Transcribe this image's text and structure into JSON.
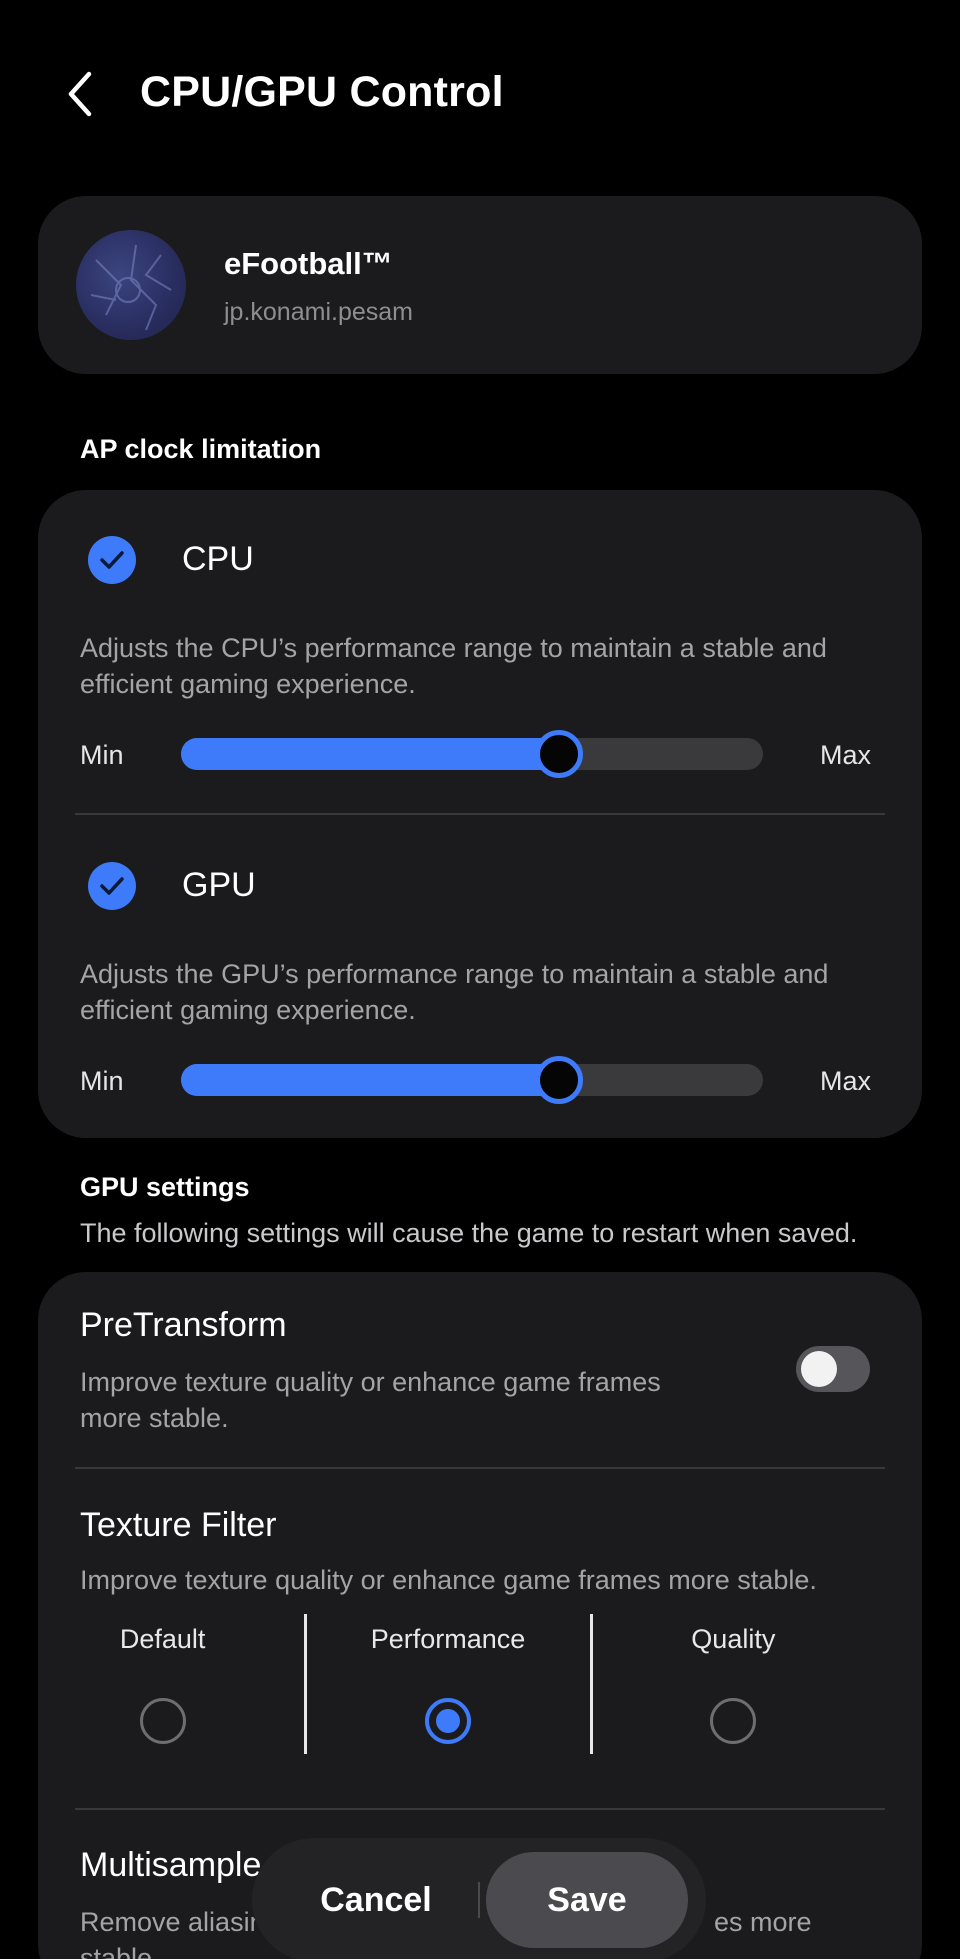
{
  "header": {
    "title": "CPU/GPU Control",
    "back_icon": "chevron-left-icon"
  },
  "app": {
    "name": "eFootball™",
    "package": "jp.konami.pesam"
  },
  "ap_clock": {
    "section_title": "AP clock limitation",
    "cpu": {
      "label": "CPU",
      "checked": true,
      "description_line1": "Adjusts the CPU’s performance range to maintain a stable and",
      "description_line2": "efficient gaming experience.",
      "min_label": "Min",
      "max_label": "Max",
      "value_fraction": 0.65
    },
    "gpu": {
      "label": "GPU",
      "checked": true,
      "description_line1": "Adjusts the GPU’s performance range to maintain a stable and",
      "description_line2": "efficient gaming experience.",
      "min_label": "Min",
      "max_label": "Max",
      "value_fraction": 0.65
    }
  },
  "gpu_settings": {
    "section_title": "GPU settings",
    "section_subtitle": "The following settings will cause the game to restart when saved.",
    "pretransform": {
      "title": "PreTransform",
      "description_line1": "Improve texture quality or enhance game frames",
      "description_line2": "more stable.",
      "enabled": false
    },
    "texture_filter": {
      "title": "Texture Filter",
      "description": "Improve texture quality or enhance game frames more stable.",
      "options": [
        "Default",
        "Performance",
        "Quality"
      ],
      "selected": "Performance"
    },
    "multisample": {
      "title": "Multisample",
      "description_start": "Remove aliasing",
      "description_end": "es more",
      "description_line2": "stable."
    }
  },
  "actions": {
    "cancel_label": "Cancel",
    "save_label": "Save"
  },
  "colors": {
    "accent": "#3e7bfa",
    "card_background": "#1b1b1d",
    "page_background": "#000000"
  }
}
